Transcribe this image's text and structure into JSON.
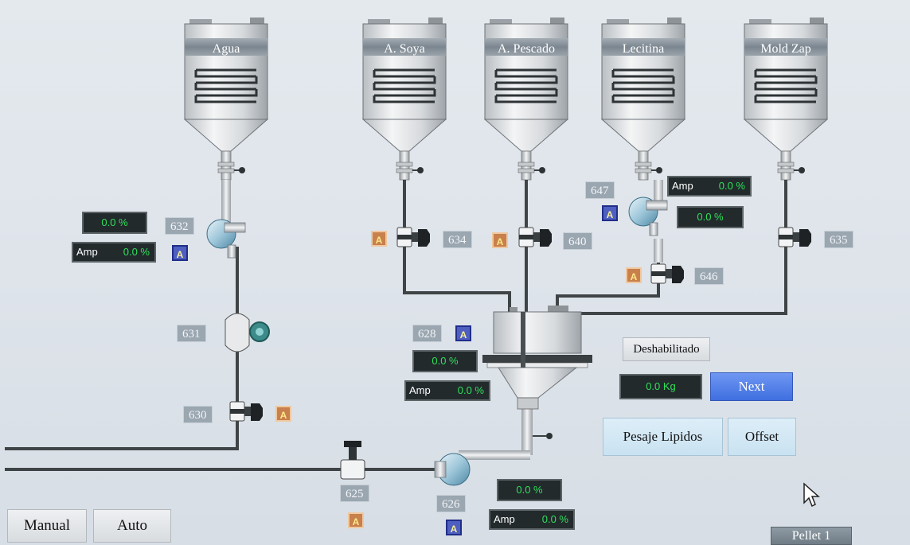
{
  "tanks": {
    "agua": "Agua",
    "soya": "A. Soya",
    "pescado": "A. Pescado",
    "lecitina": "Lecitina",
    "mold_zap": "Mold Zap"
  },
  "tags": {
    "t632": "632",
    "t634": "634",
    "t640": "640",
    "t647": "647",
    "t646": "646",
    "t635": "635",
    "t631": "631",
    "t630": "630",
    "t628": "628",
    "t625": "625",
    "t626": "626"
  },
  "mode_label": "A",
  "displays": {
    "d632_pct": "0.0 %",
    "d632_amp_label": "Amp",
    "d632_amp_val": "0.0 %",
    "d647_amp_label": "Amp",
    "d647_amp_val": "0.0 %",
    "d647_pct": "0.0 %",
    "d628_pct": "0.0 %",
    "d628_amp_label": "Amp",
    "d628_amp_val": "0.0 %",
    "d626_pct": "0.0 %",
    "d626_amp_label": "Amp",
    "d626_amp_val": "0.0 %",
    "weight": "0.0 Kg"
  },
  "buttons": {
    "deshabilitado": "Deshabilitado",
    "next": "Next",
    "pesaje": "Pesaje Lipidos",
    "offset": "Offset",
    "manual": "Manual",
    "auto": "Auto",
    "pellet": "Pellet 1"
  },
  "colors": {
    "pipe": "#3f4446",
    "tank_band": "#7d8891",
    "accent_blue": "#3f6fe0",
    "mode_orange": "#c8804c",
    "mode_blue": "#4e5fc0",
    "display_green": "#2fe05a"
  }
}
